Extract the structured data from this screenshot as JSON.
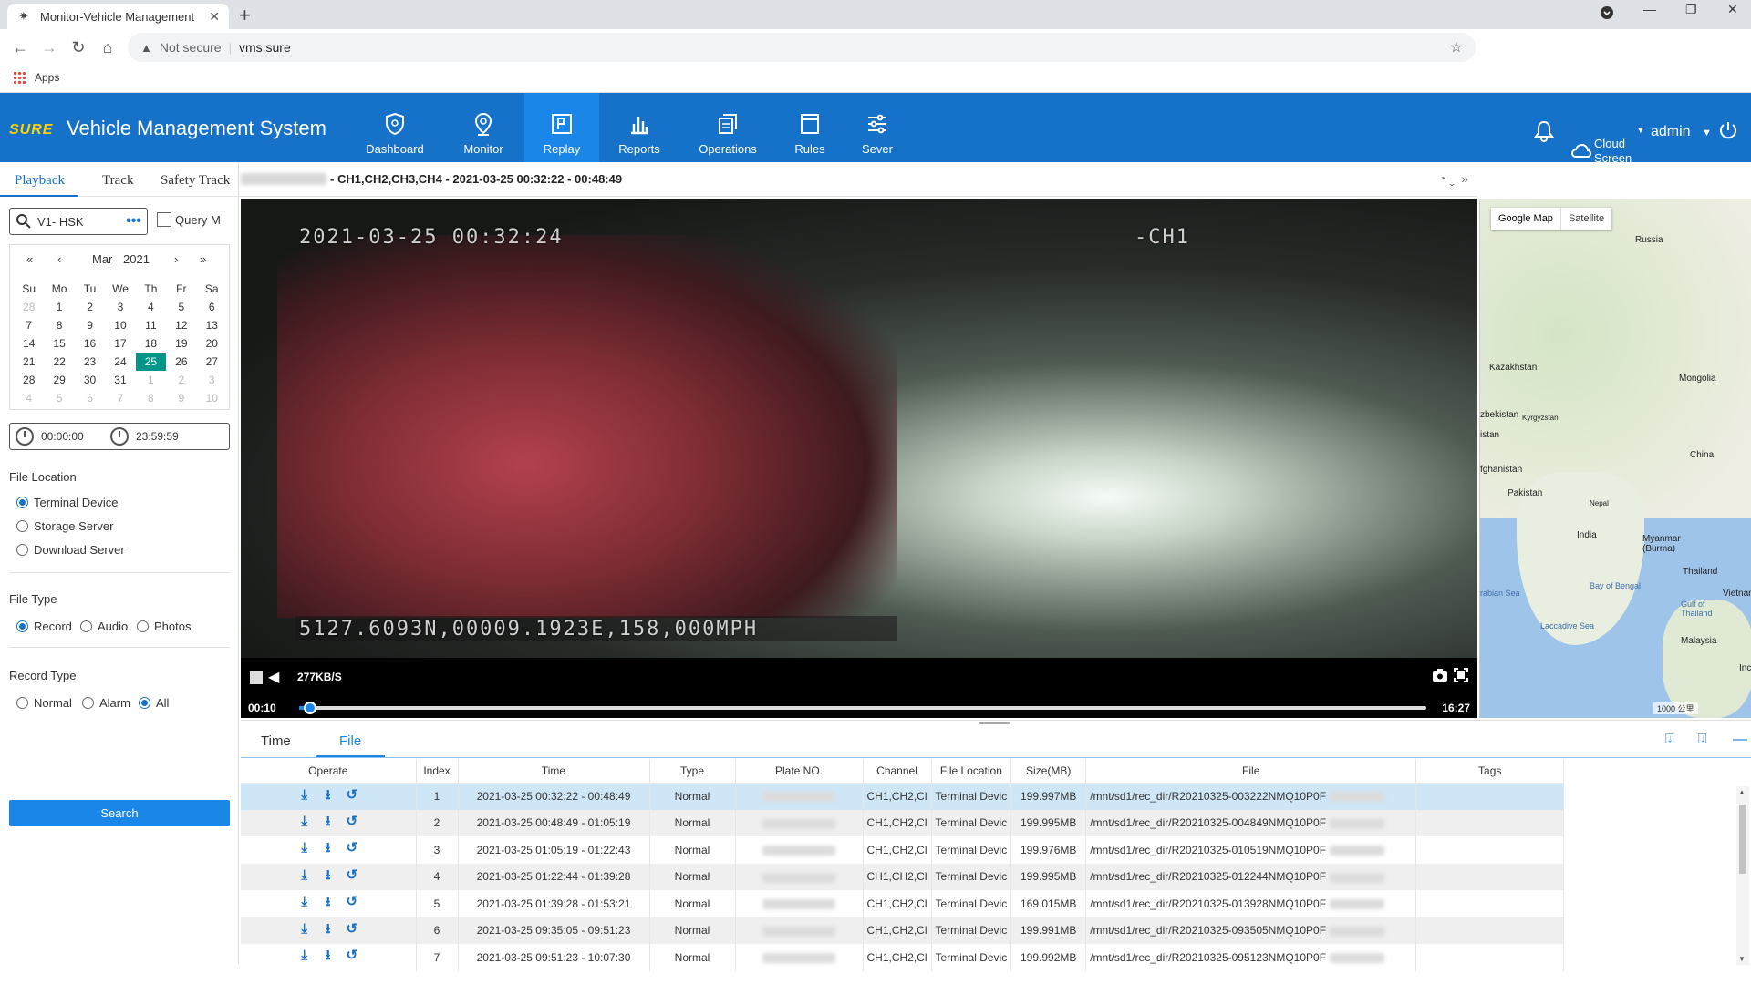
{
  "browser": {
    "tab_title": "Monitor-Vehicle Management Sy",
    "security": "Not secure",
    "url": "vms.sure",
    "bookmark_apps": "Apps"
  },
  "header": {
    "logo": "SURE",
    "title": "Vehicle Management System",
    "nav": [
      {
        "label": "Dashboard",
        "icon": "shield-icon"
      },
      {
        "label": "Monitor",
        "icon": "location-pin-icon"
      },
      {
        "label": "Replay",
        "icon": "replay-icon"
      },
      {
        "label": "Reports",
        "icon": "bar-chart-icon"
      },
      {
        "label": "Operations",
        "icon": "operations-icon"
      },
      {
        "label": "Rules",
        "icon": "rules-icon"
      },
      {
        "label": "Sever",
        "icon": "sliders-icon"
      }
    ],
    "active_nav": "Replay",
    "cloud_line1": "Cloud",
    "cloud_line2": "Screen",
    "user": "admin"
  },
  "left": {
    "tabs": [
      "Playback",
      "Track",
      "Safety Track"
    ],
    "search_value": "V1-    HSK",
    "query_label": "Query M",
    "calendar": {
      "month": "Mar",
      "year": "2021",
      "weekdays": [
        "Su",
        "Mo",
        "Tu",
        "We",
        "Th",
        "Fr",
        "Sa"
      ],
      "weeks": [
        [
          "28",
          "1",
          "2",
          "3",
          "4",
          "5",
          "6"
        ],
        [
          "7",
          "8",
          "9",
          "10",
          "11",
          "12",
          "13"
        ],
        [
          "14",
          "15",
          "16",
          "17",
          "18",
          "19",
          "20"
        ],
        [
          "21",
          "22",
          "23",
          "24",
          "25",
          "26",
          "27"
        ],
        [
          "28",
          "29",
          "30",
          "31",
          "1",
          "2",
          "3"
        ],
        [
          "4",
          "5",
          "6",
          "7",
          "8",
          "9",
          "10"
        ]
      ],
      "selected": "25"
    },
    "start_time": "00:00:00",
    "end_time": "23:59:59",
    "file_location_label": "File Location",
    "file_location_options": [
      "Terminal Device",
      "Storage Server",
      "Download Server"
    ],
    "file_location_selected": "Terminal Device",
    "file_type_label": "File Type",
    "file_type_options": [
      "Record",
      "Audio",
      "Photos"
    ],
    "file_type_selected": "Record",
    "record_type_label": "Record Type",
    "record_type_options": [
      "Normal",
      "Alarm",
      "All"
    ],
    "record_type_selected": "All",
    "search_button": "Search"
  },
  "video": {
    "title_text": "- CH1,CH2,CH3,CH4 - 2021-03-25 00:32:22 - 00:48:49",
    "osd_time": "2021-03-25  00:32:24",
    "osd_channel": "-CH1",
    "osd_gps": "5127.6093N,00009.1923E,158,000MPH",
    "rate": "277KB/S",
    "current_time": "00:10",
    "total_time": "16:27",
    "progress": 0.01
  },
  "map": {
    "buttons": [
      "Google Map",
      "Satellite"
    ],
    "labels": [
      "Russia",
      "Kazakhstan",
      "Mongolia",
      "zbekistan",
      "Kyrgyzstan",
      "istan",
      "fghanistan",
      "China",
      "Pakistan",
      "Nepal",
      "India",
      "Myanmar (Burma)",
      "Thailand",
      "Bay of Bengal",
      "rabian Sea",
      "Gulf of Thailand",
      "Vietnam",
      "Laccadive Sea",
      "Malaysia",
      "Inc"
    ],
    "scale": "1000 公里"
  },
  "files": {
    "tabs": [
      "Time",
      "File"
    ],
    "active_tab": "File",
    "columns": [
      "Operate",
      "Index",
      "Time",
      "Type",
      "Plate NO.",
      "Channel",
      "File Location",
      "Size(MB)",
      "File",
      "Tags"
    ],
    "rows": [
      {
        "index": "1",
        "time": "2021-03-25 00:32:22 - 00:48:49",
        "type": "Normal",
        "channel": "CH1,CH2,Cl",
        "location": "Terminal Devic",
        "size": "199.997MB",
        "file": "/mnt/sd1/rec_dir/R20210325-003222NMQ10P0F"
      },
      {
        "index": "2",
        "time": "2021-03-25 00:48:49 - 01:05:19",
        "type": "Normal",
        "channel": "CH1,CH2,Cl",
        "location": "Terminal Devic",
        "size": "199.995MB",
        "file": "/mnt/sd1/rec_dir/R20210325-004849NMQ10P0F"
      },
      {
        "index": "3",
        "time": "2021-03-25 01:05:19 - 01:22:43",
        "type": "Normal",
        "channel": "CH1,CH2,Cl",
        "location": "Terminal Devic",
        "size": "199.976MB",
        "file": "/mnt/sd1/rec_dir/R20210325-010519NMQ10P0F"
      },
      {
        "index": "4",
        "time": "2021-03-25 01:22:44 - 01:39:28",
        "type": "Normal",
        "channel": "CH1,CH2,Cl",
        "location": "Terminal Devic",
        "size": "199.995MB",
        "file": "/mnt/sd1/rec_dir/R20210325-012244NMQ10P0F"
      },
      {
        "index": "5",
        "time": "2021-03-25 01:39:28 - 01:53:21",
        "type": "Normal",
        "channel": "CH1,CH2,Cl",
        "location": "Terminal Devic",
        "size": "169.015MB",
        "file": "/mnt/sd1/rec_dir/R20210325-013928NMQ10P0F"
      },
      {
        "index": "6",
        "time": "2021-03-25 09:35:05 - 09:51:23",
        "type": "Normal",
        "channel": "CH1,CH2,Cl",
        "location": "Terminal Devic",
        "size": "199.991MB",
        "file": "/mnt/sd1/rec_dir/R20210325-093505NMQ10P0F"
      },
      {
        "index": "7",
        "time": "2021-03-25 09:51:23 - 10:07:30",
        "type": "Normal",
        "channel": "CH1,CH2,Cl",
        "location": "Terminal Devic",
        "size": "199.992MB",
        "file": "/mnt/sd1/rec_dir/R20210325-095123NMQ10P0F"
      }
    ]
  },
  "colors": {
    "header_blue": "#1672c9",
    "active_nav": "#1a86e8",
    "calendar_selected": "#009688",
    "logo_yellow": "#ffd000"
  }
}
